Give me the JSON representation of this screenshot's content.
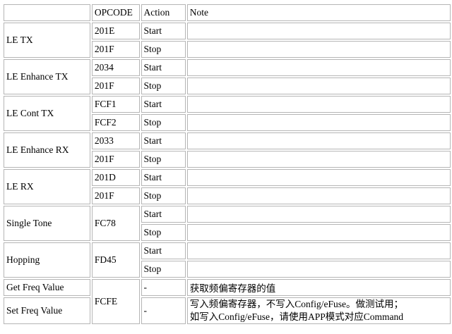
{
  "headers": [
    "",
    "OPCODE",
    "Action",
    "Note"
  ],
  "groups": [
    {
      "name": "LE TX",
      "rows": [
        {
          "opcode": "201E",
          "action": "Start"
        },
        {
          "opcode": "201F",
          "action": "Stop"
        }
      ]
    },
    {
      "name": "LE Enhance TX",
      "rows": [
        {
          "opcode": "2034",
          "action": "Start"
        },
        {
          "opcode": "201F",
          "action": "Stop"
        }
      ]
    },
    {
      "name": "LE Cont TX",
      "rows": [
        {
          "opcode": "FCF1",
          "action": "Start"
        },
        {
          "opcode": "FCF2",
          "action": "Stop"
        }
      ]
    },
    {
      "name": "LE Enhance RX",
      "rows": [
        {
          "opcode": "2033",
          "action": "Start"
        },
        {
          "opcode": "201F",
          "action": "Stop"
        }
      ]
    },
    {
      "name": "LE RX",
      "rows": [
        {
          "opcode": "201D",
          "action": "Start"
        },
        {
          "opcode": "201F",
          "action": "Stop"
        }
      ]
    },
    {
      "name": "Single Tone",
      "opcode": "FC78",
      "rows": [
        {
          "action": "Start"
        },
        {
          "action": "Stop"
        }
      ]
    },
    {
      "name": "Hopping",
      "opcode": "FD45",
      "rows": [
        {
          "action": "Start"
        },
        {
          "action": "Stop"
        }
      ]
    }
  ],
  "freq": {
    "opcode": "FCFE",
    "rows": [
      {
        "name": "Get Freq Value",
        "action": "-",
        "note": "获取频偏寄存器的值"
      },
      {
        "name": "Set Freq Value",
        "action": "-",
        "note_line1": "写入频偏寄存器，不写入Config/eFuse。做测试用；",
        "note_line2": "如写入Config/eFuse，请使用APP模式对应Command"
      }
    ]
  }
}
